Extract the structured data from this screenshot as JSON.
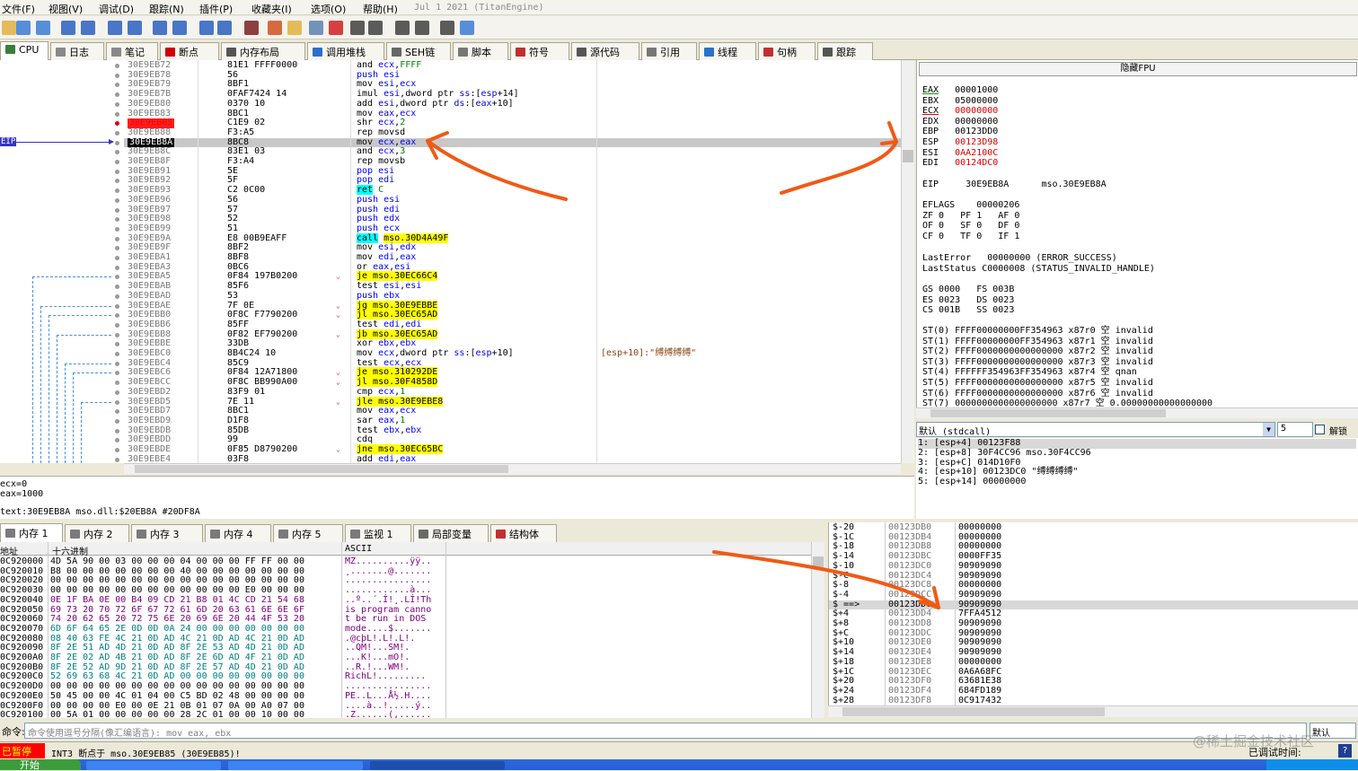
{
  "menu": {
    "items": [
      "文件(F)",
      "视图(V)",
      "调试(D)",
      "跟踪(N)",
      "插件(P)",
      "收藏夹(I)",
      "选项(O)",
      "帮助(H)"
    ],
    "version": "Jul 1 2021 (TitanEngine)"
  },
  "tabs": [
    {
      "label": "CPU",
      "icon": "cpu-icon",
      "color": "#3a7d3a"
    },
    {
      "label": "日志",
      "icon": "log-icon",
      "color": "#888"
    },
    {
      "label": "笔记",
      "icon": "notes-icon",
      "color": "#888"
    },
    {
      "label": "断点",
      "icon": "breakpoint-icon",
      "color": "#d00000"
    },
    {
      "label": "内存布局",
      "icon": "memory-map-icon",
      "color": "#555"
    },
    {
      "label": "调用堆栈",
      "icon": "call-stack-icon",
      "color": "#2a6fc9"
    },
    {
      "label": "SEH链",
      "icon": "seh-icon",
      "color": "#666"
    },
    {
      "label": "脚本",
      "icon": "script-icon",
      "color": "#777"
    },
    {
      "label": "符号",
      "icon": "symbols-icon",
      "color": "#c03030"
    },
    {
      "label": "源代码",
      "icon": "source-icon",
      "color": "#555"
    },
    {
      "label": "引用",
      "icon": "references-icon",
      "color": "#777"
    },
    {
      "label": "线程",
      "icon": "threads-icon",
      "color": "#2a6fc9"
    },
    {
      "label": "句柄",
      "icon": "handles-icon",
      "color": "#c03030"
    },
    {
      "label": "跟踪",
      "icon": "trace-icon",
      "color": "#555"
    }
  ],
  "disasm": [
    {
      "addr": "30E9EB72",
      "bytes": "81E1 FFFF0000",
      "ins": [
        [
          "mn",
          "and "
        ],
        [
          "reg",
          "ecx"
        ],
        [
          "mn",
          ","
        ],
        [
          "num",
          "FFFF"
        ]
      ]
    },
    {
      "addr": "30E9EB78",
      "bytes": "56",
      "ins": [
        [
          "pushc",
          "push "
        ],
        [
          "reg",
          "esi"
        ]
      ]
    },
    {
      "addr": "30E9EB79",
      "bytes": "8BF1",
      "ins": [
        [
          "mn",
          "mov "
        ],
        [
          "reg",
          "esi"
        ],
        [
          "mn",
          ","
        ],
        [
          "reg",
          "ecx"
        ]
      ]
    },
    {
      "addr": "30E9EB7B",
      "bytes": "0FAF7424 14",
      "ins": [
        [
          "mn",
          "imul "
        ],
        [
          "reg",
          "esi"
        ],
        [
          "mn",
          ",dword ptr "
        ],
        [
          "reg",
          "ss"
        ],
        [
          "mn",
          ":["
        ],
        [
          "reg",
          "esp"
        ],
        [
          "mn",
          "+14]"
        ]
      ]
    },
    {
      "addr": "30E9EB80",
      "bytes": "0370 10",
      "ins": [
        [
          "mn",
          "add "
        ],
        [
          "reg",
          "esi"
        ],
        [
          "mn",
          ",dword ptr "
        ],
        [
          "reg",
          "ds"
        ],
        [
          "mn",
          ":["
        ],
        [
          "reg",
          "eax"
        ],
        [
          "mn",
          "+10]"
        ]
      ]
    },
    {
      "addr": "30E9EB83",
      "bytes": "8BC1",
      "ins": [
        [
          "mn",
          "mov "
        ],
        [
          "reg",
          "eax"
        ],
        [
          "mn",
          ","
        ],
        [
          "reg",
          "ecx"
        ]
      ]
    },
    {
      "addr": "30E9EB85",
      "bytes": "C1E9 02",
      "ins": [
        [
          "mn",
          "shr "
        ],
        [
          "reg",
          "ecx"
        ],
        [
          "mn",
          ","
        ],
        [
          "num",
          "2"
        ]
      ],
      "mark": "bp"
    },
    {
      "addr": "30E9EB88",
      "bytes": "F3:A5",
      "ins": [
        [
          "mn",
          "rep movsd"
        ]
      ]
    },
    {
      "addr": "30E9EB8A",
      "bytes": "8BC8",
      "ins": [
        [
          "mn",
          "mov "
        ],
        [
          "reg",
          "ecx"
        ],
        [
          "mn",
          ","
        ],
        [
          "reg",
          "eax"
        ]
      ],
      "mark": "eip"
    },
    {
      "addr": "30E9EB8C",
      "bytes": "83E1 03",
      "ins": [
        [
          "mn",
          "and "
        ],
        [
          "reg",
          "ecx"
        ],
        [
          "mn",
          ","
        ],
        [
          "num",
          "3"
        ]
      ]
    },
    {
      "addr": "30E9EB8F",
      "bytes": "F3:A4",
      "ins": [
        [
          "mn",
          "rep movsb"
        ]
      ]
    },
    {
      "addr": "30E9EB91",
      "bytes": "5E",
      "ins": [
        [
          "pushc",
          "pop "
        ],
        [
          "reg",
          "esi"
        ]
      ]
    },
    {
      "addr": "30E9EB92",
      "bytes": "5F",
      "ins": [
        [
          "pushc",
          "pop "
        ],
        [
          "reg",
          "edi"
        ]
      ]
    },
    {
      "addr": "30E9EB93",
      "bytes": "C2 0C00",
      "ins": [
        [
          "retbg",
          "ret"
        ],
        [
          "mn",
          " "
        ],
        [
          "num",
          "C"
        ]
      ]
    },
    {
      "addr": "30E9EB96",
      "bytes": "56",
      "ins": [
        [
          "pushc",
          "push "
        ],
        [
          "reg",
          "esi"
        ]
      ]
    },
    {
      "addr": "30E9EB97",
      "bytes": "57",
      "ins": [
        [
          "pushc",
          "push "
        ],
        [
          "reg",
          "edi"
        ]
      ]
    },
    {
      "addr": "30E9EB98",
      "bytes": "52",
      "ins": [
        [
          "pushc",
          "push "
        ],
        [
          "reg",
          "edx"
        ]
      ]
    },
    {
      "addr": "30E9EB99",
      "bytes": "51",
      "ins": [
        [
          "pushc",
          "push "
        ],
        [
          "reg",
          "ecx"
        ]
      ]
    },
    {
      "addr": "30E9EB9A",
      "bytes": "E8 00B9EAFF",
      "ins": [
        [
          "callbg",
          "call"
        ],
        [
          "mn",
          " "
        ],
        [
          "jmpyel",
          "mso.30D4A49F"
        ]
      ]
    },
    {
      "addr": "30E9EB9F",
      "bytes": "8BF2",
      "ins": [
        [
          "mn",
          "mov "
        ],
        [
          "reg",
          "esi"
        ],
        [
          "mn",
          ","
        ],
        [
          "reg",
          "edx"
        ]
      ]
    },
    {
      "addr": "30E9EBA1",
      "bytes": "8BF8",
      "ins": [
        [
          "mn",
          "mov "
        ],
        [
          "reg",
          "edi"
        ],
        [
          "mn",
          ","
        ],
        [
          "reg",
          "eax"
        ]
      ]
    },
    {
      "addr": "30E9EBA3",
      "bytes": "0BC6",
      "ins": [
        [
          "mn",
          "or "
        ],
        [
          "reg",
          "eax"
        ],
        [
          "mn",
          ","
        ],
        [
          "reg",
          "esi"
        ]
      ]
    },
    {
      "addr": "30E9EBA5",
      "bytes": "0F84 197B0200",
      "ins": [
        [
          "jmpyel",
          "je mso.30EC66C4"
        ]
      ],
      "arrow": true
    },
    {
      "addr": "30E9EBAB",
      "bytes": "85F6",
      "ins": [
        [
          "mn",
          "test "
        ],
        [
          "reg",
          "esi"
        ],
        [
          "mn",
          ","
        ],
        [
          "reg",
          "esi"
        ]
      ]
    },
    {
      "addr": "30E9EBAD",
      "bytes": "53",
      "ins": [
        [
          "pushc",
          "push "
        ],
        [
          "reg",
          "ebx"
        ]
      ]
    },
    {
      "addr": "30E9EBAE",
      "bytes": "7F 0E",
      "ins": [
        [
          "jmpyel",
          "jg mso.30E9EBBE"
        ]
      ],
      "arrow": true
    },
    {
      "addr": "30E9EBB0",
      "bytes": "0F8C F7790200",
      "ins": [
        [
          "jmpyel",
          "jl mso.30EC65AD"
        ]
      ],
      "arrow": true
    },
    {
      "addr": "30E9EBB6",
      "bytes": "85FF",
      "ins": [
        [
          "mn",
          "test "
        ],
        [
          "reg",
          "edi"
        ],
        [
          "mn",
          ","
        ],
        [
          "reg",
          "edi"
        ]
      ]
    },
    {
      "addr": "30E9EBB8",
      "bytes": "0F82 EF790200",
      "ins": [
        [
          "jmpyel",
          "jb mso.30EC65AD"
        ]
      ],
      "arrow": true
    },
    {
      "addr": "30E9EBBE",
      "bytes": "33DB",
      "ins": [
        [
          "mn",
          "xor "
        ],
        [
          "reg",
          "ebx"
        ],
        [
          "mn",
          ","
        ],
        [
          "reg",
          "ebx"
        ]
      ]
    },
    {
      "addr": "30E9EBC0",
      "bytes": "8B4C24 10",
      "ins": [
        [
          "mn",
          "mov "
        ],
        [
          "reg",
          "ecx"
        ],
        [
          "mn",
          ",dword ptr "
        ],
        [
          "reg",
          "ss"
        ],
        [
          "mn",
          ":["
        ],
        [
          "reg",
          "esp"
        ],
        [
          "mn",
          "+10]"
        ]
      ],
      "comment": "[esp+10]:\"缚缚缚缚\""
    },
    {
      "addr": "30E9EBC4",
      "bytes": "85C9",
      "ins": [
        [
          "mn",
          "test "
        ],
        [
          "reg",
          "ecx"
        ],
        [
          "mn",
          ","
        ],
        [
          "reg",
          "ecx"
        ]
      ]
    },
    {
      "addr": "30E9EBC6",
      "bytes": "0F84 12A71800",
      "ins": [
        [
          "jmpyel",
          "je mso.310292DE"
        ]
      ],
      "arrow": true
    },
    {
      "addr": "30E9EBCC",
      "bytes": "0F8C BB990A00",
      "ins": [
        [
          "jmpyel",
          "jl mso.30F4858D"
        ]
      ],
      "arrow": true
    },
    {
      "addr": "30E9EBD2",
      "bytes": "83F9 01",
      "ins": [
        [
          "mn",
          "cmp "
        ],
        [
          "reg",
          "ecx"
        ],
        [
          "mn",
          ","
        ],
        [
          "num",
          "1"
        ]
      ]
    },
    {
      "addr": "30E9EBD5",
      "bytes": "7E 11",
      "ins": [
        [
          "jmpyel",
          "jle mso.30E9EBE8"
        ]
      ],
      "arrow": true
    },
    {
      "addr": "30E9EBD7",
      "bytes": "8BC1",
      "ins": [
        [
          "mn",
          "mov "
        ],
        [
          "reg",
          "eax"
        ],
        [
          "mn",
          ","
        ],
        [
          "reg",
          "ecx"
        ]
      ]
    },
    {
      "addr": "30E9EBD9",
      "bytes": "D1F8",
      "ins": [
        [
          "mn",
          "sar "
        ],
        [
          "reg",
          "eax"
        ],
        [
          "mn",
          ","
        ],
        [
          "num",
          "1"
        ]
      ]
    },
    {
      "addr": "30E9EBDB",
      "bytes": "85DB",
      "ins": [
        [
          "mn",
          "test "
        ],
        [
          "reg",
          "ebx"
        ],
        [
          "mn",
          ","
        ],
        [
          "reg",
          "ebx"
        ]
      ]
    },
    {
      "addr": "30E9EBDD",
      "bytes": "99",
      "ins": [
        [
          "mn",
          "cdq"
        ]
      ]
    },
    {
      "addr": "30E9EBDE",
      "bytes": "0F85 D8790200",
      "ins": [
        [
          "jmpyel",
          "jne mso.30EC65BC"
        ]
      ],
      "arrow": true
    },
    {
      "addr": "30E9EBE4",
      "bytes": "03F8",
      "ins": [
        [
          "mn",
          "add "
        ],
        [
          "reg",
          "edi"
        ],
        [
          "mn",
          ","
        ],
        [
          "reg",
          "eax"
        ]
      ]
    }
  ],
  "eip_label": "EIP",
  "info": {
    "line1": "ecx=0",
    "line2": "eax=1000",
    "line3": "text:30E9EB8A mso.dll:$20EB8A #20DF8A"
  },
  "fpu": {
    "title": "隐藏FPU",
    "regs": [
      [
        "EAX",
        "00001000"
      ],
      [
        "EBX",
        "05000000"
      ],
      [
        "ECX",
        "00000000"
      ],
      [
        "EDX",
        "00000000"
      ],
      [
        "EBP",
        "00123DD0"
      ],
      [
        "ESP",
        "00123D98"
      ],
      [
        "ESI",
        "0AA2100C"
      ],
      [
        "EDI",
        "00124DC0"
      ]
    ],
    "eip": "EIP     30E9EB8A      mso.30E9EB8A",
    "eflags": [
      "EFLAGS    00000206",
      "ZF 0   PF 1   AF 0",
      "OF 0   SF 0   DF 0",
      "CF 0   TF 0   IF 1"
    ],
    "last": [
      "LastError   00000000 (ERROR_SUCCESS)",
      "LastStatus C0000008 (STATUS_INVALID_HANDLE)"
    ],
    "segs": [
      "GS 0000   FS 003B",
      "ES 0023   DS 0023",
      "CS 001B   SS 0023"
    ],
    "st": [
      "ST(0) FFFF00000000FF354963 x87r0 空 invalid",
      "ST(1) FFFF00000000FF354963 x87r1 空 invalid",
      "ST(2) FFFF0000000000000000 x87r2 空 invalid",
      "ST(3) FFFF0000000000000000 x87r3 空 invalid",
      "ST(4) FFFFFF354963FF354963 x87r4 空 qnan",
      "ST(5) FFFF0000000000000000 x87r5 空 invalid",
      "ST(6) FFFF0000000000000000 x87r6 空 invalid",
      "ST(7) 0000000000000000000 x87r7 空 0.00000000000000000"
    ]
  },
  "callconv": {
    "label": "默认 (stdcall)",
    "count": "5",
    "unlock": "解锁",
    "args": [
      "1: [esp+4] 00123F88",
      "2: [esp+8] 30F4CC96 mso.30F4CC96",
      "3: [esp+C] 014D10F0",
      "4: [esp+10] 00123DC0 \"缚缚缚缚\"",
      "5: [esp+14] 00000000"
    ]
  },
  "memtabs": [
    "内存 1",
    "内存 2",
    "内存 3",
    "内存 4",
    "内存 5",
    "监视 1",
    "局部变量",
    "结构体"
  ],
  "memhdr": {
    "addr": "地址",
    "hex": "十六进制",
    "ascii": "ASCII"
  },
  "hexrows": [
    [
      "0C920000",
      "4D 5A 90 00 03 00 00 00 04 00 00 00 FF FF 00 00",
      "MZ..........ÿÿ.."
    ],
    [
      "0C920010",
      "B8 00 00 00 00 00 00 00 40 00 00 00 00 00 00 00",
      "¸.......@......."
    ],
    [
      "0C920020",
      "00 00 00 00 00 00 00 00 00 00 00 00 00 00 00 00",
      "................"
    ],
    [
      "0C920030",
      "00 00 00 00 00 00 00 00 00 00 00 00 E0 00 00 00",
      "............à..."
    ],
    [
      "0C920040",
      "0E 1F BA 0E 00 B4 09 CD 21 B8 01 4C CD 21 54 68",
      "..º..´.Í!¸.LÍ!Th"
    ],
    [
      "0C920050",
      "69 73 20 70 72 6F 67 72 61 6D 20 63 61 6E 6E 6F",
      "is program canno"
    ],
    [
      "0C920060",
      "74 20 62 65 20 72 75 6E 20 69 6E 20 44 4F 53 20",
      "t be run in DOS "
    ],
    [
      "0C920070",
      "6D 6F 64 65 2E 0D 0D 0A 24 00 00 00 00 00 00 00",
      "mode....$......."
    ],
    [
      "0C920080",
      "08 40 63 FE 4C 21 0D AD 4C 21 0D AD 4C 21 0D AD",
      ".@cþL!.­L!.­L!.­"
    ],
    [
      "0C920090",
      "8F 2E 51 AD 4D 21 0D AD 8F 2E 53 AD 4D 21 0D AD",
      "..Q­M!.­..S­M!.­"
    ],
    [
      "0C9200A0",
      "8F 2E 02 AD 4B 21 0D AD 8F 2E 6D AD 4F 21 0D AD",
      "...­K!.­..m­O!.­"
    ],
    [
      "0C9200B0",
      "8F 2E 52 AD 9D 21 0D AD 8F 2E 57 AD 4D 21 0D AD",
      "..R­.!.­..W­M!.­"
    ],
    [
      "0C9200C0",
      "52 69 63 68 4C 21 0D AD 00 00 00 00 00 00 00 00",
      "RichL!.­........"
    ],
    [
      "0C9200D0",
      "00 00 00 00 00 00 00 00 00 00 00 00 00 00 00 00",
      "................"
    ],
    [
      "0C9200E0",
      "50 45 00 00 4C 01 04 00 C5 BD 02 48 00 00 00 00",
      "PE..L...Å½.H...."
    ],
    [
      "0C9200F0",
      "00 00 00 00 E0 00 0E 21 0B 01 07 0A 00 A0 07 00",
      "....à..!.....ý.."
    ],
    [
      "0C920100",
      "00 5A 01 00 00 00 00 00 28 2C 01 00 00 10 00 00",
      ".Z......(,......"
    ]
  ],
  "stack": [
    [
      "$-20",
      "00123DB0",
      "00000000"
    ],
    [
      "$-1C",
      "00123DB4",
      "00000000"
    ],
    [
      "$-18",
      "00123DB8",
      "00000000"
    ],
    [
      "$-14",
      "00123DBC",
      "0000FF35"
    ],
    [
      "$-10",
      "00123DC0",
      "90909090"
    ],
    [
      "$-C",
      "00123DC4",
      "90909090"
    ],
    [
      "$-8",
      "00123DC8",
      "00000000"
    ],
    [
      "$-4",
      "00123DCC",
      "90909090"
    ],
    [
      "$ ==>",
      "00123DD0",
      "90909090"
    ],
    [
      "$+4",
      "00123DD4",
      "7FFA4512"
    ],
    [
      "$+8",
      "00123DD8",
      "90909090"
    ],
    [
      "$+C",
      "00123DDC",
      "90909090"
    ],
    [
      "$+10",
      "00123DE0",
      "90909090"
    ],
    [
      "$+14",
      "00123DE4",
      "90909090"
    ],
    [
      "$+18",
      "00123DE8",
      "00000000"
    ],
    [
      "$+1C",
      "00123DEC",
      "0A6A68FC"
    ],
    [
      "$+20",
      "00123DF0",
      "63681E38"
    ],
    [
      "$+24",
      "00123DF4",
      "684FD189"
    ],
    [
      "$+28",
      "00123DF8",
      "0C917432"
    ]
  ],
  "cmd": {
    "label": "命令:",
    "placeholder": "命令使用逗号分隔(像汇编语言): mov eax, ebx",
    "default": "默认"
  },
  "status": {
    "paused": "已暂停",
    "message": "INT3 断点于 mso.30E9EB85 (30E9EB85)!",
    "debugtime": "已调试时间:",
    "watermark": "@稀土掘金技术社区"
  },
  "taskbar": {
    "start": "开始"
  }
}
